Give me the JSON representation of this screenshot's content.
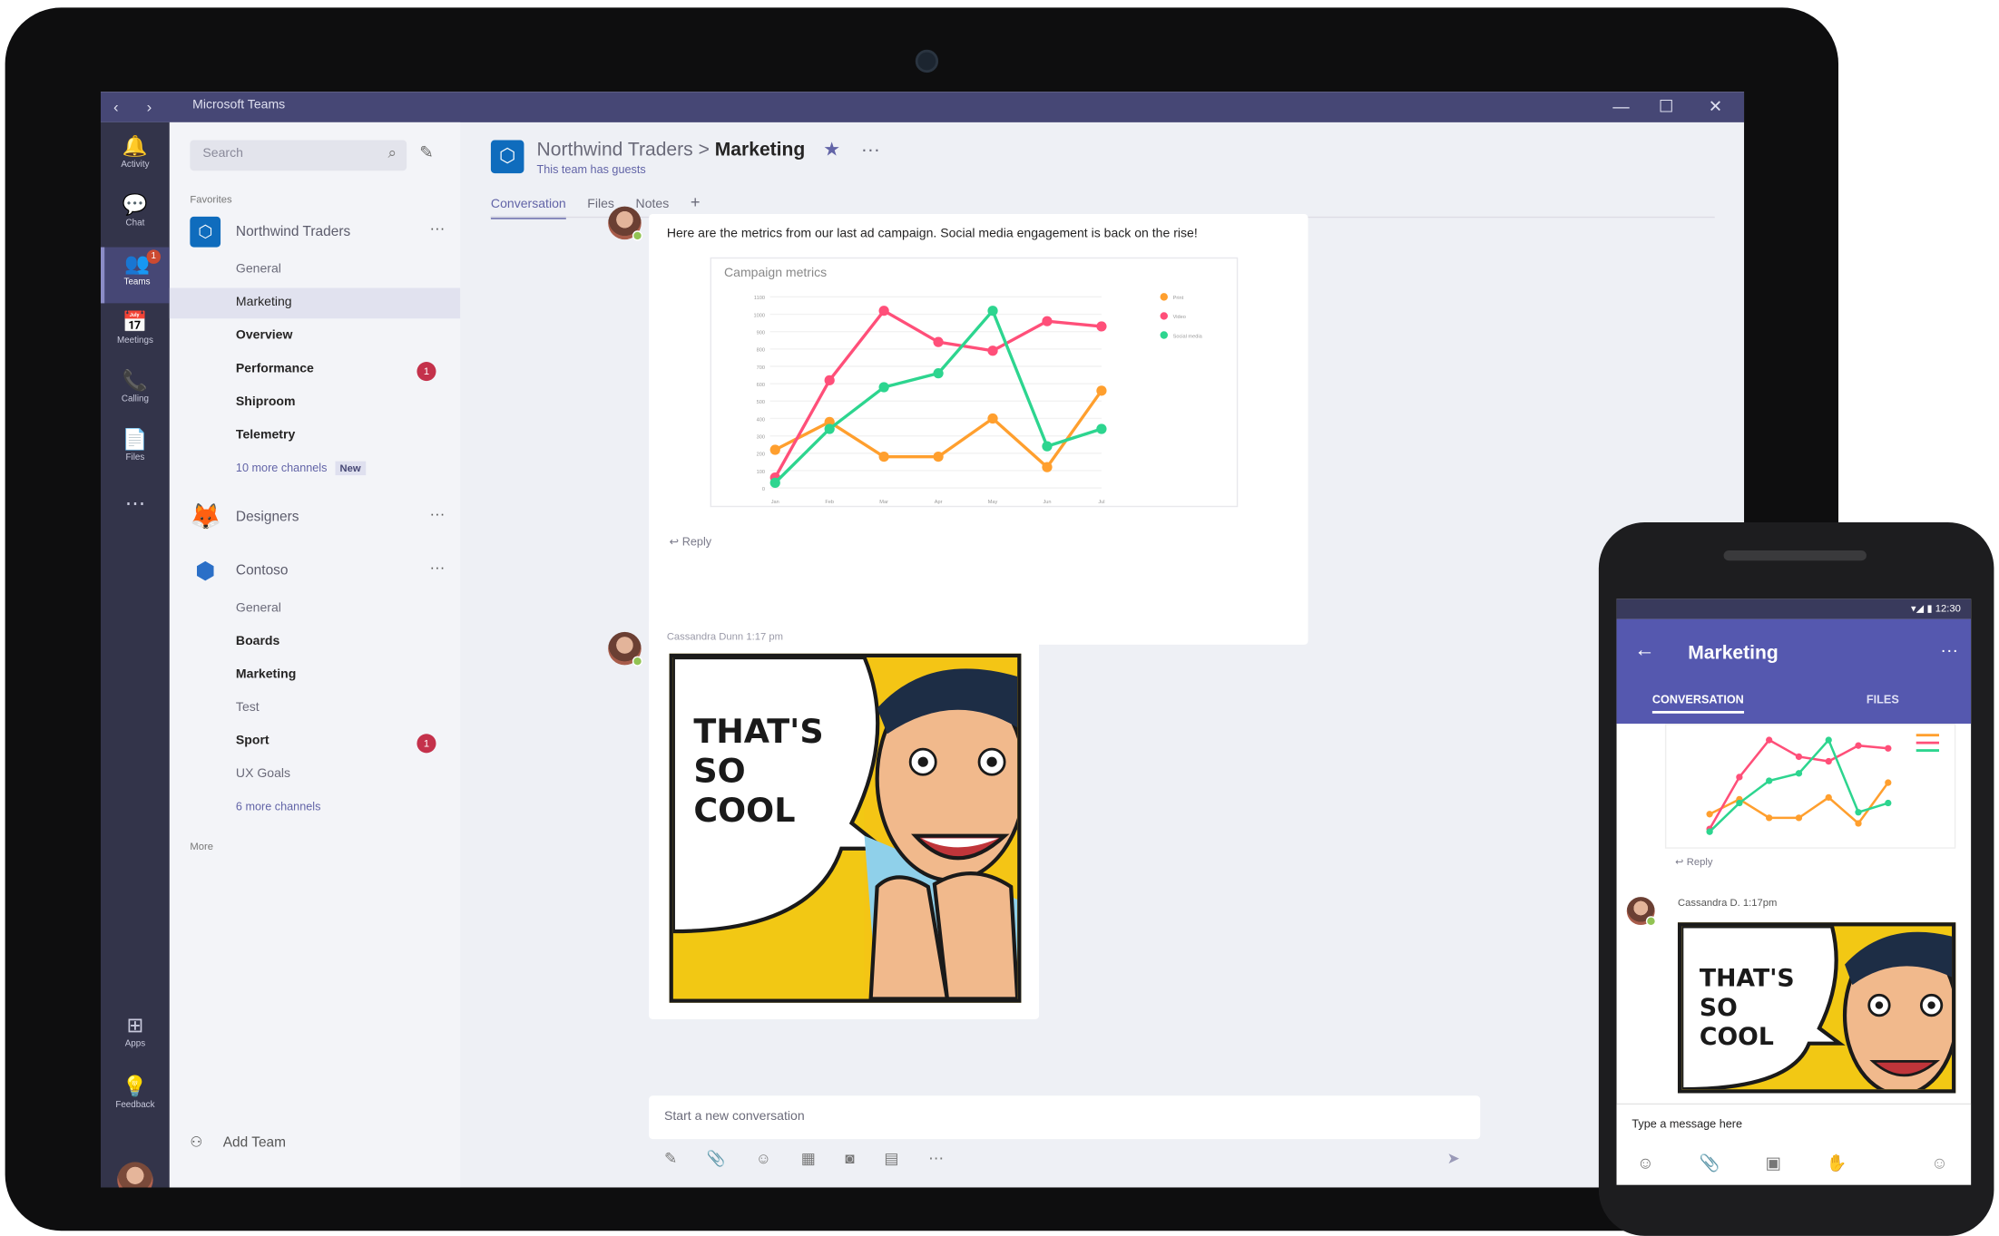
{
  "window": {
    "title": "Microsoft Teams",
    "back": "‹",
    "forward": "›",
    "minimize": "—",
    "maximize": "☐",
    "close": "✕"
  },
  "rail": [
    {
      "label": "Activity",
      "icon": "🔔"
    },
    {
      "label": "Chat",
      "icon": "💬"
    },
    {
      "label": "Teams",
      "icon": "👥",
      "badge": "1"
    },
    {
      "label": "Meetings",
      "icon": "📅"
    },
    {
      "label": "Calling",
      "icon": "📞"
    },
    {
      "label": "Files",
      "icon": "📄"
    },
    {
      "label": "",
      "icon": "⋯"
    },
    {
      "label": "Apps",
      "icon": "⊞"
    },
    {
      "label": "Feedback",
      "icon": "💡"
    }
  ],
  "sidebar": {
    "search_placeholder": "Search",
    "favorites_label": "Favorites",
    "teams": [
      {
        "name": "Northwind Traders",
        "more": "···",
        "channels": [
          {
            "name": "General",
            "bold": false
          },
          {
            "name": "Marketing",
            "bold": false,
            "selected": true
          },
          {
            "name": "Overview",
            "bold": true
          },
          {
            "name": "Performance",
            "bold": true,
            "badge": "1"
          },
          {
            "name": "Shiproom",
            "bold": true
          },
          {
            "name": "Telemetry",
            "bold": true
          }
        ],
        "more_channels": "10 more channels",
        "new_tag": "New"
      },
      {
        "name": "Designers",
        "more": "···",
        "channels": []
      },
      {
        "name": "Contoso",
        "more": "···",
        "channels": [
          {
            "name": "General",
            "bold": false
          },
          {
            "name": "Boards",
            "bold": true
          },
          {
            "name": "Marketing",
            "bold": true
          },
          {
            "name": "Test",
            "bold": false
          },
          {
            "name": "Sport",
            "bold": true,
            "badge": "1"
          },
          {
            "name": "UX Goals",
            "bold": false
          }
        ],
        "more_channels": "6 more channels"
      }
    ],
    "more_label": "More",
    "add_team": "Add Team"
  },
  "header": {
    "team": "Northwind Traders",
    "separator": ">",
    "channel": "Marketing",
    "star": "★",
    "more": "···",
    "guests": "This team has guests",
    "tabs": [
      "Conversation",
      "Files",
      "Notes",
      "+"
    ]
  },
  "post1": {
    "text": "Here are the metrics from our last ad campaign. Social media engagement is back on the rise!",
    "reply": "Reply"
  },
  "chart_data": {
    "type": "line",
    "title": "Campaign metrics",
    "categories": [
      "Jan",
      "Feb",
      "Mar",
      "Apr",
      "May",
      "Jun",
      "Jul"
    ],
    "ylim": [
      0,
      1100
    ],
    "yticks": [
      0,
      100,
      200,
      300,
      400,
      500,
      600,
      700,
      800,
      900,
      1000,
      1100
    ],
    "series": [
      {
        "name": "Print",
        "color": "#ff9f2e",
        "values": [
          220,
          380,
          180,
          180,
          400,
          120,
          560
        ]
      },
      {
        "name": "Video",
        "color": "#ff4f79",
        "values": [
          60,
          620,
          1020,
          840,
          790,
          960,
          930
        ]
      },
      {
        "name": "Social media",
        "color": "#2dd58f",
        "values": [
          30,
          340,
          580,
          660,
          1020,
          240,
          340
        ]
      }
    ],
    "legend_position": "top-right"
  },
  "post2": {
    "author": "Cassandra Dunn",
    "time": "1:17 pm",
    "comic_text": [
      "THAT'S",
      "SO",
      "COOL"
    ]
  },
  "composer": {
    "placeholder": "Start a new conversation",
    "tools": "✎ 📎 ☺ ▦ ◙ ▤ ⋯",
    "send": "➤"
  },
  "phone": {
    "status": "▾◢ ▮ 12:30",
    "title": "Marketing",
    "back": "←",
    "more": "···",
    "tabs": [
      "CONVERSATION",
      "FILES"
    ],
    "reply": "Reply",
    "meta": "Cassandra D.  1:17pm",
    "comic_text": [
      "THAT'S",
      "SO",
      "COOL"
    ],
    "input_placeholder": "Type a message here",
    "tools": "☺ 📎 ▣ ✋",
    "emoji": "☺"
  }
}
